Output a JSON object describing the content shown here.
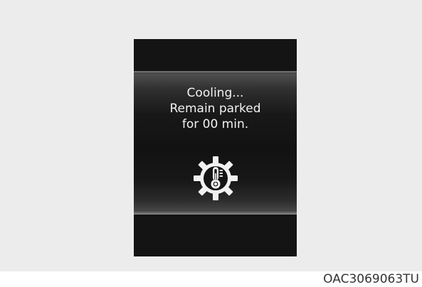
{
  "display": {
    "message_line1": "Cooling...",
    "message_line2": "Remain parked",
    "message_line3": "for 00 min.",
    "icon": "gear-thermometer-icon"
  },
  "caption": {
    "code": "OAC3069063TU"
  },
  "colors": {
    "figure_background": "#ececec",
    "display_background": "#121212",
    "text": "#f2f2f2"
  }
}
